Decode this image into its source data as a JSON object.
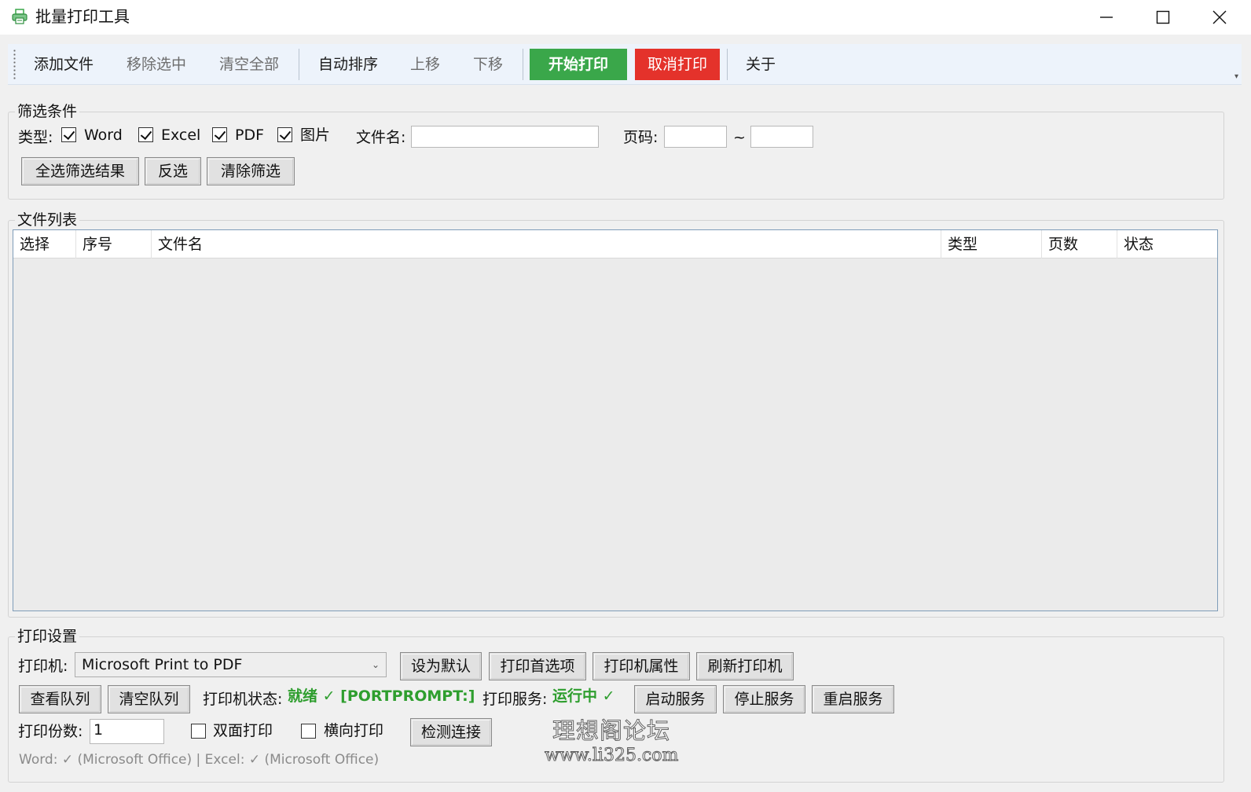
{
  "window": {
    "title": "批量打印工具",
    "icon": "printer-icon",
    "controls": {
      "minimize": "minimize-icon",
      "maximize": "maximize-icon",
      "close": "close-icon"
    }
  },
  "toolbar": {
    "add_files": "添加文件",
    "remove_selected": "移除选中",
    "clear_all": "清空全部",
    "auto_sort": "自动排序",
    "move_up": "上移",
    "move_down": "下移",
    "start_print": "开始打印",
    "cancel_print": "取消打印",
    "about": "关于",
    "colors": {
      "start": "#3aa74a",
      "cancel": "#e4322b"
    }
  },
  "filter": {
    "title": "筛选条件",
    "type_label": "类型:",
    "types": [
      {
        "label": "Word",
        "checked": true
      },
      {
        "label": "Excel",
        "checked": true
      },
      {
        "label": "PDF",
        "checked": true
      },
      {
        "label": "图片",
        "checked": true
      }
    ],
    "filename_label": "文件名:",
    "filename_value": "",
    "page_label": "页码:",
    "page_from": "",
    "page_sep": "~",
    "page_to": "",
    "select_all_results": "全选筛选结果",
    "invert_selection": "反选",
    "clear_filter": "清除筛选"
  },
  "file_list": {
    "title": "文件列表",
    "columns": [
      "选择",
      "序号",
      "文件名",
      "类型",
      "页数",
      "状态"
    ],
    "rows": []
  },
  "print_settings": {
    "title": "打印设置",
    "printer_label": "打印机:",
    "printer_selected": "Microsoft Print to PDF",
    "set_default": "设为默认",
    "preferences": "打印首选项",
    "printer_properties": "打印机属性",
    "refresh_printers": "刷新打印机",
    "view_queue": "查看队列",
    "clear_queue": "清空队列",
    "printer_status_label": "打印机状态:",
    "printer_status_value": "就绪 ✓ [PORTPROMPT:]",
    "print_service_label": "打印服务:",
    "print_service_value": "运行中 ✓",
    "start_service": "启动服务",
    "stop_service": "停止服务",
    "restart_service": "重启服务",
    "copies_label": "打印份数:",
    "copies_value": "1",
    "duplex_label": "双面打印",
    "duplex_checked": false,
    "landscape_label": "横向打印",
    "landscape_checked": false,
    "check_connection": "检测连接",
    "office_status": "Word: ✓ (Microsoft Office) | Excel: ✓ (Microsoft Office)",
    "status_color": "#2e9e2e"
  },
  "watermark": {
    "line1": "理想阁论坛",
    "line2": "www.li325.com"
  }
}
